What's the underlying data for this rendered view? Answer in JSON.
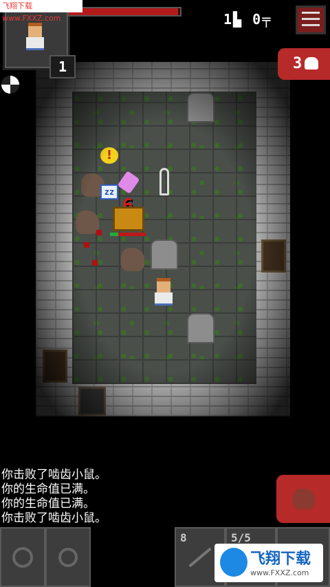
{
  "watermark_top": "飞翔下载 www.FXXZ.com",
  "hud": {
    "hero_level": "1",
    "hp_fraction": 0.98,
    "depth": "1",
    "keys": "0",
    "danger_count": "3"
  },
  "board": {
    "damage_number": "6",
    "alert_glyph": "!",
    "sleep_glyph": "zz"
  },
  "log": [
    "你击败了啮齿小鼠。",
    "你的生命值已满。",
    "你的生命值已满。",
    "你击败了啮齿小鼠。"
  ],
  "toolbar": {
    "quickslot1_count": "8",
    "quickslot2_count": "5/5"
  },
  "watermark_bottom": {
    "title": "飞翔下载",
    "url": "www.FXXZ.com"
  },
  "colors": {
    "accent_red": "#b72a2a",
    "floor": "#4a4f4a",
    "wall": "#b9b9b9"
  },
  "icons": [
    "menu-icon",
    "skull-icon",
    "compass-icon",
    "wait-icon",
    "search-icon",
    "dart-icon",
    "rat-icon"
  ]
}
